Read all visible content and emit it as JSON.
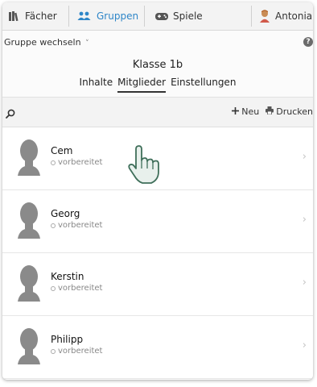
{
  "nav": {
    "items": [
      {
        "label": "Fächer",
        "icon": "books-icon"
      },
      {
        "label": "Gruppen",
        "icon": "group-icon",
        "active": true
      },
      {
        "label": "Spiele",
        "icon": "gamepad-icon"
      }
    ],
    "user": {
      "label": "Antonia",
      "icon": "user-avatar-icon"
    }
  },
  "group_switch": {
    "label": "Gruppe wechseln",
    "caret": "˅",
    "help": "?"
  },
  "class_title": "Klasse 1b",
  "tabs": [
    {
      "label": "Inhalte"
    },
    {
      "label": "Mitglieder",
      "active": true
    },
    {
      "label": "Einstellungen"
    }
  ],
  "toolbar": {
    "search_icon": "search-icon",
    "new_label": "Neu",
    "print_label": "Drucken"
  },
  "members": [
    {
      "name": "Cem",
      "status": "vorbereitet"
    },
    {
      "name": "Georg",
      "status": "vorbereitet"
    },
    {
      "name": "Kerstin",
      "status": "vorbereitet"
    },
    {
      "name": "Philipp",
      "status": "vorbereitet"
    }
  ],
  "colors": {
    "accent": "#2e86c8",
    "avatar": "#8a8a8a",
    "background": "#fbfbfb"
  }
}
